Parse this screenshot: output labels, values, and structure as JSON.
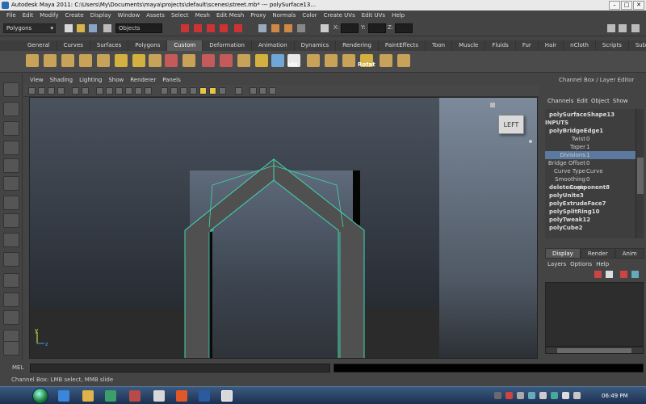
{
  "window": {
    "title": "Autodesk Maya 2011: C:\\Users\\My\\Documents\\maya\\projects\\default\\scenes\\street.mb*   ---   polySurface13...",
    "min": "–",
    "max": "□",
    "close": "✕"
  },
  "menubar": [
    "File",
    "Edit",
    "Modify",
    "Create",
    "Display",
    "Window",
    "Assets",
    "Select",
    "Mesh",
    "Edit Mesh",
    "Proxy",
    "Normals",
    "Color",
    "Create UVs",
    "Edit UVs",
    "Help"
  ],
  "status_line": {
    "mode": "Polygons",
    "objects_field": "Objects",
    "x_label": "X:",
    "y_label": "Y:",
    "z_label": "Z:"
  },
  "shelf": {
    "tabs": [
      "General",
      "Curves",
      "Surfaces",
      "Polygons",
      "Custom",
      "Deformation",
      "Animation",
      "Dynamics",
      "Rendering",
      "PaintEffects",
      "Toon",
      "Muscle",
      "Fluids",
      "Fur",
      "Hair",
      "nCloth",
      "Scripts",
      "Subdivs"
    ],
    "active_tab": "Custom",
    "his_label": "His",
    "rotat_label": "Rotat"
  },
  "panel": {
    "menu": [
      "View",
      "Shading",
      "Lighting",
      "Show",
      "Renderer",
      "Panels"
    ]
  },
  "viewcube": {
    "face": "LEFT"
  },
  "channel_box": {
    "title": "Channel Box / Layer Editor",
    "menu": [
      "Channels",
      "Edit",
      "Object",
      "Show"
    ],
    "shape": "polySurfaceShape13",
    "inputs_label": "INPUTS",
    "bridge_node": "polyBridgeEdge1",
    "attributes": [
      {
        "name": "Twist",
        "value": "0"
      },
      {
        "name": "Taper",
        "value": "1"
      },
      {
        "name": "Divisions",
        "value": "1"
      },
      {
        "name": "Bridge Offset",
        "value": "0"
      },
      {
        "name": "Curve Type",
        "value": "Curve"
      },
      {
        "name": "Smoothing Angle",
        "value": "0"
      }
    ],
    "history": [
      "deleteComponent8",
      "polyUnite3",
      "polyExtrudeFace7",
      "polySplitRing10",
      "polyTweak12",
      "polyCube2"
    ]
  },
  "layer_editor": {
    "tabs": [
      "Display",
      "Render",
      "Anim"
    ],
    "menu": [
      "Layers",
      "Options",
      "Help"
    ]
  },
  "command_line": {
    "label": "MEL"
  },
  "help_line": "Channel Box: LMB select, MMB slide",
  "taskbar": {
    "clock": "06:49 PM"
  },
  "colors": {
    "ui_bg": "#444444",
    "viewport_top": "#4a525e",
    "wireframe": "#3fd9b0",
    "selection": "#5c7aa0"
  }
}
